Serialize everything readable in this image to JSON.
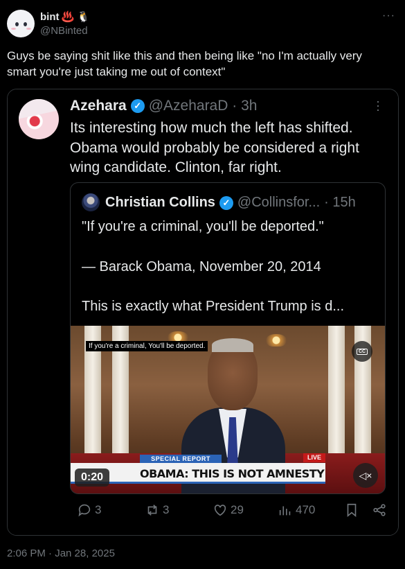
{
  "author": {
    "name": "bint",
    "emojis": "♨️ 🐧",
    "handle": "@NBinted"
  },
  "menu_icon": "more-horizontal-icon",
  "tweet": {
    "text": "Guys be saying shit like this and then being like \"no I'm actually very smart you're just taking me out of context\"",
    "timestamp": "2:06 PM · Jan 28, 2025"
  },
  "embedded": {
    "name": "Azehara",
    "handle": "@AzeharaD · 3h",
    "text": "Its interesting how much the left has shifted. Obama would probably be considered a right wing candidate.  Clinton, far right.",
    "quote": {
      "name": "Christian Collins",
      "handle": "@Collinsfor...",
      "time": "· 15h",
      "line1": "\"If you're a criminal, you'll be deported.\"",
      "line2": "— Barack Obama, November 20, 2014",
      "line3": "This is exactly what President Trump is d...",
      "video": {
        "subtitle": "If you're a criminal, You'll be deported.",
        "cc": "CC",
        "banner_label": "SPECIAL REPORT",
        "live": "LIVE",
        "banner_text": "OBAMA: THIS IS NOT AMNESTY",
        "time": "0:20"
      }
    },
    "actions": {
      "replies": "3",
      "reposts": "3",
      "likes": "29",
      "views": "470"
    }
  },
  "colors": {
    "background": "#000000",
    "text": "#e7e9ea",
    "muted": "#71767b",
    "verified": "#1d9bf0",
    "border": "#2f3336"
  }
}
